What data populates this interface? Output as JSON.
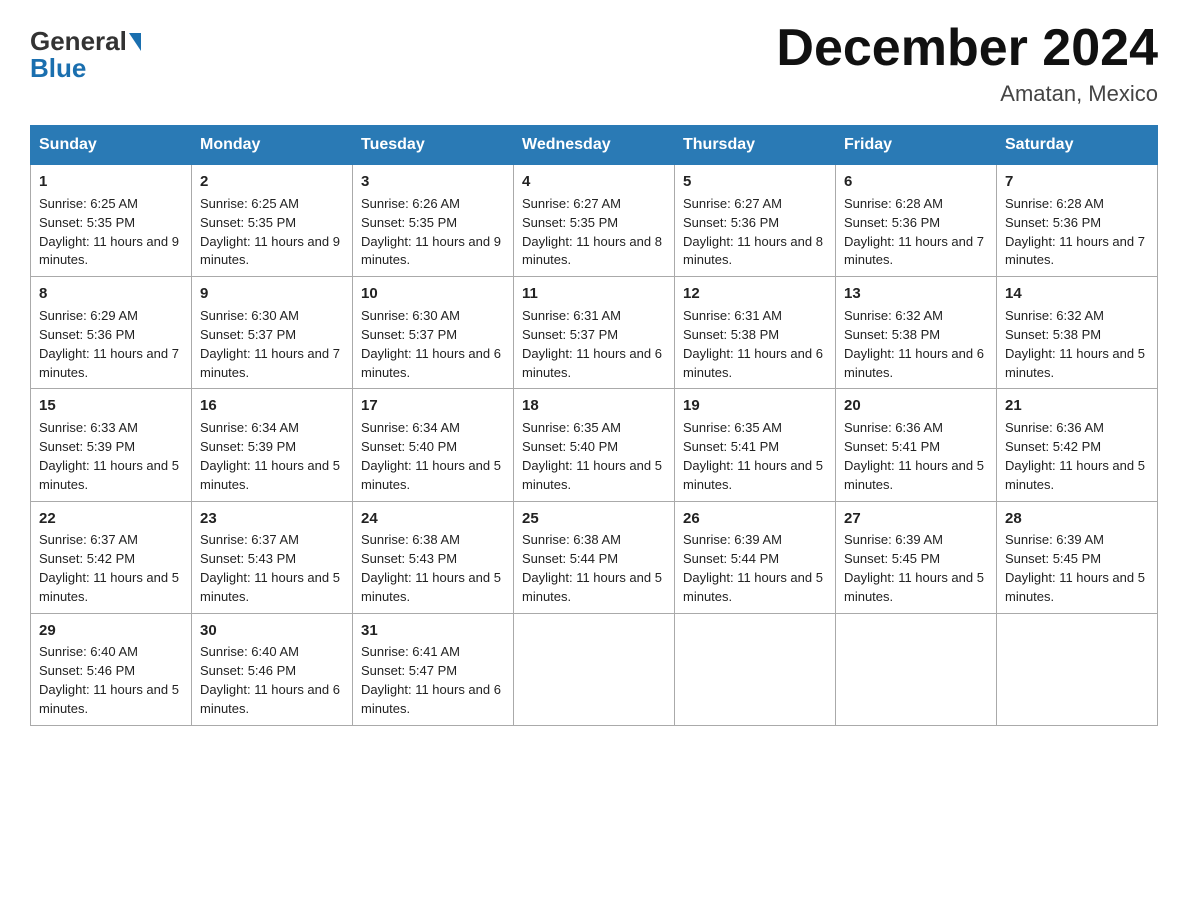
{
  "header": {
    "logo_general": "General",
    "logo_blue": "Blue",
    "month_title": "December 2024",
    "location": "Amatan, Mexico"
  },
  "weekdays": [
    "Sunday",
    "Monday",
    "Tuesday",
    "Wednesday",
    "Thursday",
    "Friday",
    "Saturday"
  ],
  "weeks": [
    [
      {
        "day": "1",
        "sunrise": "6:25 AM",
        "sunset": "5:35 PM",
        "daylight": "11 hours and 9 minutes."
      },
      {
        "day": "2",
        "sunrise": "6:25 AM",
        "sunset": "5:35 PM",
        "daylight": "11 hours and 9 minutes."
      },
      {
        "day": "3",
        "sunrise": "6:26 AM",
        "sunset": "5:35 PM",
        "daylight": "11 hours and 9 minutes."
      },
      {
        "day": "4",
        "sunrise": "6:27 AM",
        "sunset": "5:35 PM",
        "daylight": "11 hours and 8 minutes."
      },
      {
        "day": "5",
        "sunrise": "6:27 AM",
        "sunset": "5:36 PM",
        "daylight": "11 hours and 8 minutes."
      },
      {
        "day": "6",
        "sunrise": "6:28 AM",
        "sunset": "5:36 PM",
        "daylight": "11 hours and 7 minutes."
      },
      {
        "day": "7",
        "sunrise": "6:28 AM",
        "sunset": "5:36 PM",
        "daylight": "11 hours and 7 minutes."
      }
    ],
    [
      {
        "day": "8",
        "sunrise": "6:29 AM",
        "sunset": "5:36 PM",
        "daylight": "11 hours and 7 minutes."
      },
      {
        "day": "9",
        "sunrise": "6:30 AM",
        "sunset": "5:37 PM",
        "daylight": "11 hours and 7 minutes."
      },
      {
        "day": "10",
        "sunrise": "6:30 AM",
        "sunset": "5:37 PM",
        "daylight": "11 hours and 6 minutes."
      },
      {
        "day": "11",
        "sunrise": "6:31 AM",
        "sunset": "5:37 PM",
        "daylight": "11 hours and 6 minutes."
      },
      {
        "day": "12",
        "sunrise": "6:31 AM",
        "sunset": "5:38 PM",
        "daylight": "11 hours and 6 minutes."
      },
      {
        "day": "13",
        "sunrise": "6:32 AM",
        "sunset": "5:38 PM",
        "daylight": "11 hours and 6 minutes."
      },
      {
        "day": "14",
        "sunrise": "6:32 AM",
        "sunset": "5:38 PM",
        "daylight": "11 hours and 5 minutes."
      }
    ],
    [
      {
        "day": "15",
        "sunrise": "6:33 AM",
        "sunset": "5:39 PM",
        "daylight": "11 hours and 5 minutes."
      },
      {
        "day": "16",
        "sunrise": "6:34 AM",
        "sunset": "5:39 PM",
        "daylight": "11 hours and 5 minutes."
      },
      {
        "day": "17",
        "sunrise": "6:34 AM",
        "sunset": "5:40 PM",
        "daylight": "11 hours and 5 minutes."
      },
      {
        "day": "18",
        "sunrise": "6:35 AM",
        "sunset": "5:40 PM",
        "daylight": "11 hours and 5 minutes."
      },
      {
        "day": "19",
        "sunrise": "6:35 AM",
        "sunset": "5:41 PM",
        "daylight": "11 hours and 5 minutes."
      },
      {
        "day": "20",
        "sunrise": "6:36 AM",
        "sunset": "5:41 PM",
        "daylight": "11 hours and 5 minutes."
      },
      {
        "day": "21",
        "sunrise": "6:36 AM",
        "sunset": "5:42 PM",
        "daylight": "11 hours and 5 minutes."
      }
    ],
    [
      {
        "day": "22",
        "sunrise": "6:37 AM",
        "sunset": "5:42 PM",
        "daylight": "11 hours and 5 minutes."
      },
      {
        "day": "23",
        "sunrise": "6:37 AM",
        "sunset": "5:43 PM",
        "daylight": "11 hours and 5 minutes."
      },
      {
        "day": "24",
        "sunrise": "6:38 AM",
        "sunset": "5:43 PM",
        "daylight": "11 hours and 5 minutes."
      },
      {
        "day": "25",
        "sunrise": "6:38 AM",
        "sunset": "5:44 PM",
        "daylight": "11 hours and 5 minutes."
      },
      {
        "day": "26",
        "sunrise": "6:39 AM",
        "sunset": "5:44 PM",
        "daylight": "11 hours and 5 minutes."
      },
      {
        "day": "27",
        "sunrise": "6:39 AM",
        "sunset": "5:45 PM",
        "daylight": "11 hours and 5 minutes."
      },
      {
        "day": "28",
        "sunrise": "6:39 AM",
        "sunset": "5:45 PM",
        "daylight": "11 hours and 5 minutes."
      }
    ],
    [
      {
        "day": "29",
        "sunrise": "6:40 AM",
        "sunset": "5:46 PM",
        "daylight": "11 hours and 5 minutes."
      },
      {
        "day": "30",
        "sunrise": "6:40 AM",
        "sunset": "5:46 PM",
        "daylight": "11 hours and 6 minutes."
      },
      {
        "day": "31",
        "sunrise": "6:41 AM",
        "sunset": "5:47 PM",
        "daylight": "11 hours and 6 minutes."
      },
      null,
      null,
      null,
      null
    ]
  ],
  "labels": {
    "sunrise": "Sunrise:",
    "sunset": "Sunset:",
    "daylight": "Daylight:"
  }
}
